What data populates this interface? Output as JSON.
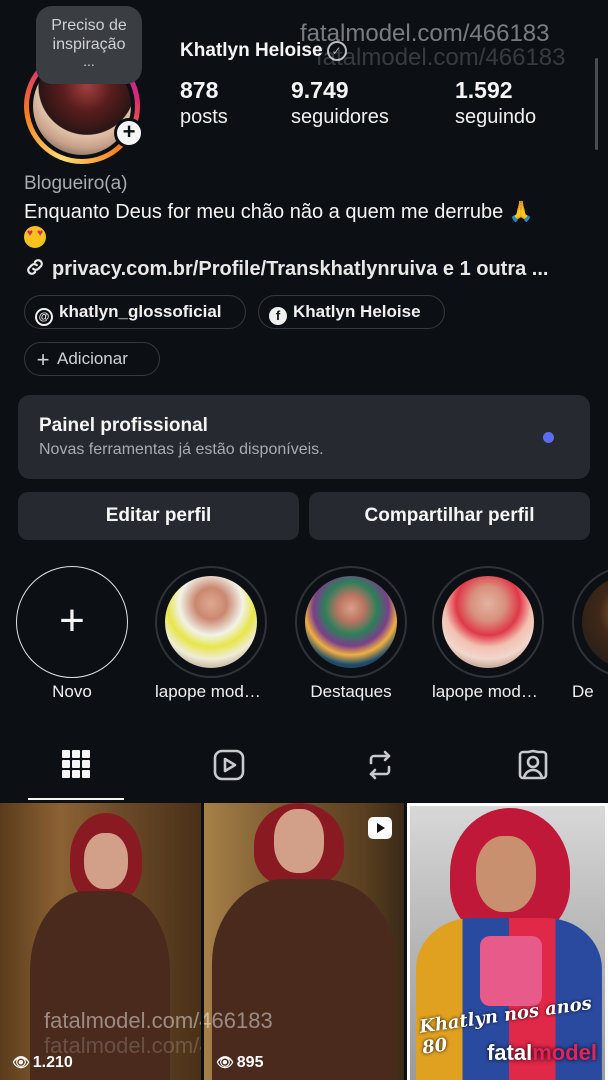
{
  "profile": {
    "note": "Preciso de inspiração",
    "note_ellipsis": "...",
    "name": "Khatlyn Heloise",
    "verified_icon": "verified-check-icon"
  },
  "stats": {
    "posts_value": "878",
    "posts_label": "posts",
    "followers_value": "9.749",
    "followers_label": "seguidores",
    "following_value": "1.592",
    "following_label": "seguindo"
  },
  "watermark": {
    "text": "fatalmodel.com/466183"
  },
  "bio": {
    "category": "Blogueiro(a)",
    "line1": "Enquanto Deus for meu chão não a quem me derrube",
    "link": "privacy.com.br/Profile/Transkhatlynruiva e 1 outra ..."
  },
  "chips": {
    "threads": "khatlyn_glossoficial",
    "facebook": "Khatlyn Heloise",
    "add": "Adicionar"
  },
  "pro_panel": {
    "title": "Painel profissional",
    "subtitle": "Novas ferramentas já estão disponíveis.",
    "dot_color": "#5b6cf0"
  },
  "buttons": {
    "edit": "Editar perfil",
    "share": "Compartilhar perfil"
  },
  "highlights": [
    {
      "label": "Novo"
    },
    {
      "label": "lapope modat..."
    },
    {
      "label": "Destaques"
    },
    {
      "label": "lapope modat..."
    },
    {
      "label": "De"
    }
  ],
  "tabs": [
    {
      "icon": "grid-icon",
      "active": true
    },
    {
      "icon": "reels-icon",
      "active": false
    },
    {
      "icon": "reposts-icon",
      "active": false
    },
    {
      "icon": "tagged-icon",
      "active": false
    }
  ],
  "posts": [
    {
      "views": "1.210",
      "watermark": "fatalmodel.com/466183"
    },
    {
      "views": "895",
      "is_reel": true
    },
    {
      "caption": "Khatlyn nos anos 80",
      "logo_text_1": "fatal",
      "logo_text_2": "model"
    }
  ],
  "colors": {
    "background": "#0c1014",
    "panel": "#262a30",
    "accent_blue": "#5b6cf0"
  }
}
